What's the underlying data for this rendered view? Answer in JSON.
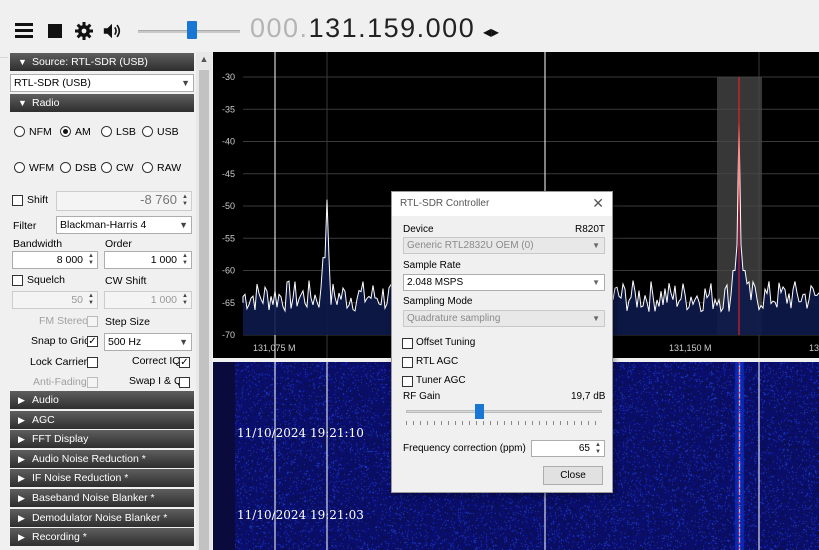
{
  "toolbar": {
    "freq_dim": "000.",
    "freq_main": "131.159.000",
    "tune_arrows": "◂▸"
  },
  "source": {
    "header": "Source: RTL-SDR (USB)",
    "selected": "RTL-SDR (USB)"
  },
  "radio": {
    "header": "Radio",
    "modes": [
      "NFM",
      "AM",
      "LSB",
      "USB",
      "WFM",
      "DSB",
      "CW",
      "RAW"
    ],
    "selected_mode": "AM",
    "shift_label": "Shift",
    "shift_value": "-8 760",
    "filter_label": "Filter",
    "filter_value": "Blackman-Harris 4",
    "bandwidth_label": "Bandwidth",
    "bandwidth_value": "8 000",
    "order_label": "Order",
    "order_value": "1 000",
    "squelch_label": "Squelch",
    "cw_shift_label": "CW Shift",
    "squelch_value": "50",
    "cw_shift_value": "1 000",
    "fm_stereo_label": "FM Stereo",
    "step_size_label": "Step Size",
    "snap_label": "Snap to Grid",
    "step_value": "500 Hz",
    "lock_carrier_label": "Lock Carrier",
    "correct_iq_label": "Correct IQ",
    "anti_fading_label": "Anti-Fading",
    "swap_iq_label": "Swap I & Q"
  },
  "sections": [
    "Audio",
    "AGC",
    "FFT Display",
    "Audio Noise Reduction *",
    "IF Noise Reduction *",
    "Baseband Noise Blanker *",
    "Demodulator Noise Blanker *",
    "Recording *"
  ],
  "spectrum": {
    "db_labels": [
      "-30",
      "-35",
      "-40",
      "-45",
      "-50",
      "-55",
      "-60",
      "-65",
      "-70"
    ],
    "freq_labels": [
      "131,075 M",
      "131,150 M",
      "13"
    ]
  },
  "waterfall": {
    "timestamps": [
      "11/10/2024 19:21:10",
      "11/10/2024 19:21:03"
    ]
  },
  "dialog": {
    "title": "RTL-SDR Controller",
    "device_label": "Device",
    "tuner": "R820T",
    "device_value": "Generic RTL2832U OEM (0)",
    "sample_rate_label": "Sample Rate",
    "sample_rate_value": "2.048 MSPS",
    "sampling_mode_label": "Sampling Mode",
    "sampling_mode_value": "Quadrature sampling",
    "offset_tuning_label": "Offset Tuning",
    "rtl_agc_label": "RTL AGC",
    "tuner_agc_label": "Tuner AGC",
    "rf_gain_label": "RF Gain",
    "rf_gain_value": "19,7 dB",
    "rf_gain_level": 0.37,
    "freq_corr_label": "Frequency correction (ppm)",
    "freq_corr_value": "65",
    "close_label": "Close"
  },
  "colors": {
    "accent": "#1976d2",
    "spectrum_trace": "#ffffff",
    "spectrum_fill": "#0d1a4a",
    "center_marker": "#ff2020"
  }
}
